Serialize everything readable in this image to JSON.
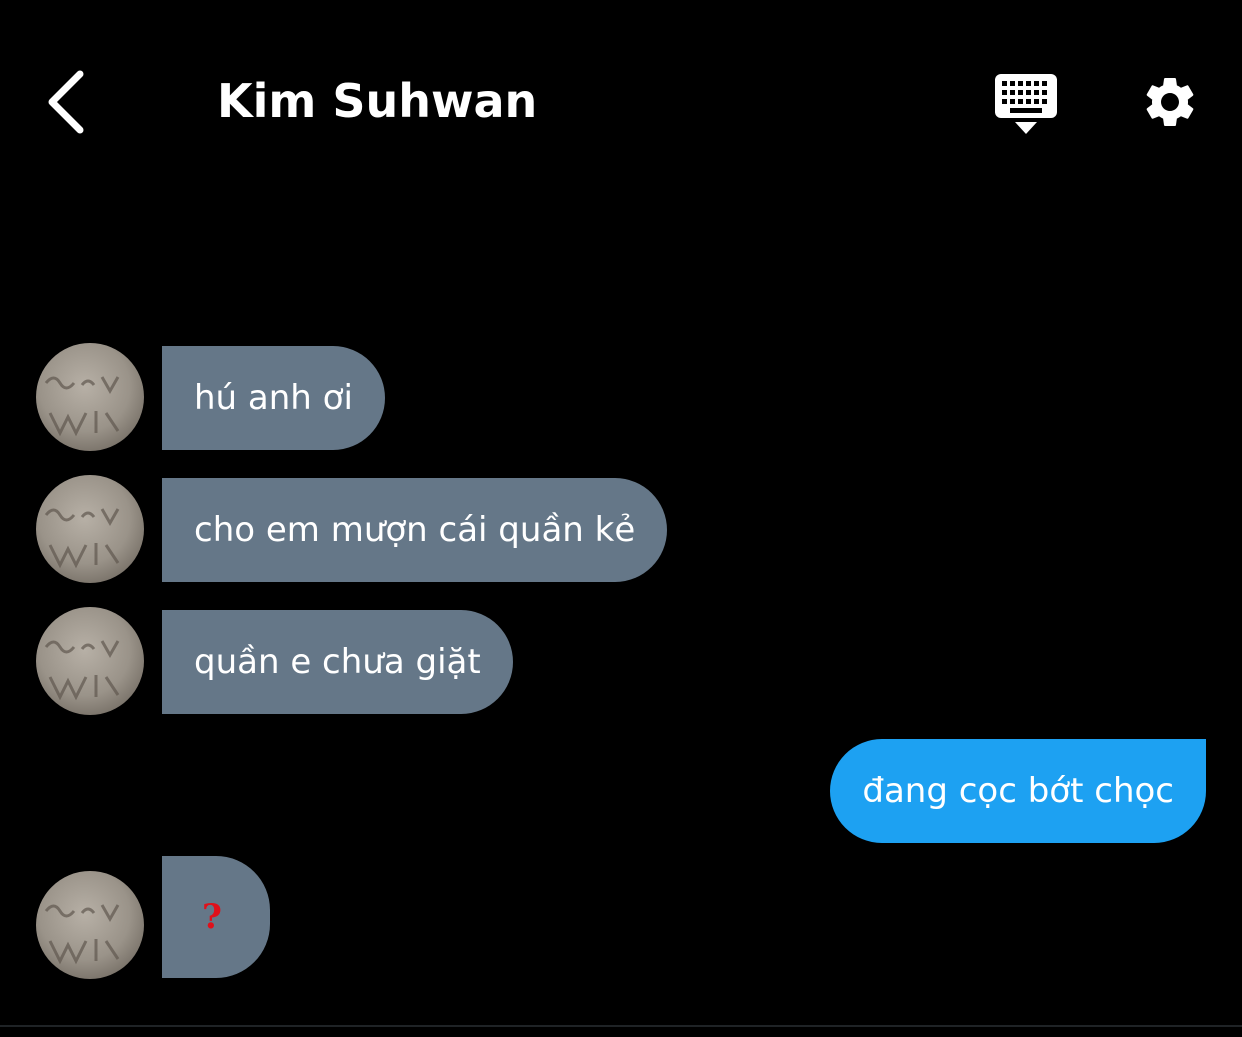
{
  "header": {
    "title": "Kim Suhwan",
    "back_icon": "chevron-left-icon",
    "keyboard_icon": "keyboard-hide-icon",
    "settings_icon": "gear-icon"
  },
  "messages": [
    {
      "sender": "other",
      "text": "hú anh ơi"
    },
    {
      "sender": "other",
      "text": "cho em mượn cái quần kẻ"
    },
    {
      "sender": "other",
      "text": "quần e chưa giặt"
    },
    {
      "sender": "me",
      "text": "đang cọc bớt chọc"
    },
    {
      "sender": "other",
      "text": "?"
    }
  ],
  "colors": {
    "background": "#000000",
    "incoming_bubble": "#657788",
    "outgoing_bubble": "#1da1f2",
    "question_mark": "#e0101a",
    "text": "#ffffff"
  }
}
